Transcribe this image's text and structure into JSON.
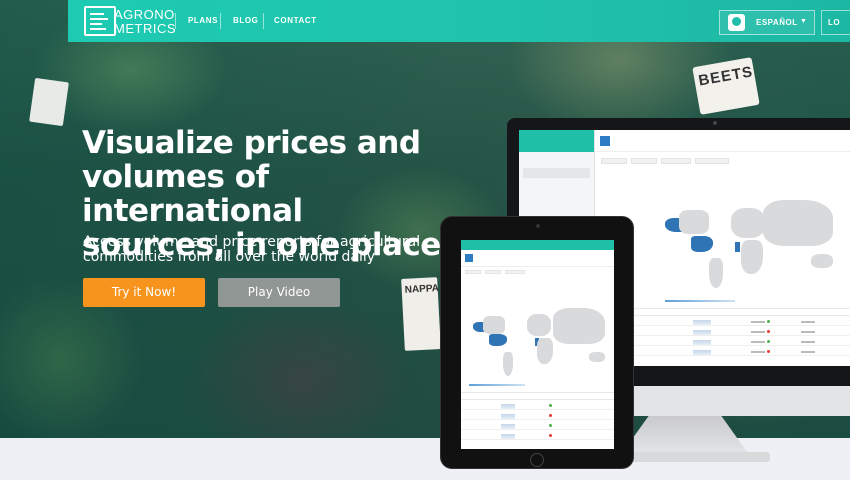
{
  "nav": {
    "brand_line1": "AGRONO",
    "brand_line2": "METRICS",
    "links": [
      "PLANS",
      "BLOG",
      "CONTACT"
    ],
    "language": "ESPAÑOL",
    "login": "LO"
  },
  "hero": {
    "headline_line1": "Visualize prices and",
    "headline_line2": "volumes of international",
    "headline_line3": "sources, in one place",
    "subline_line1": "Access volume and price reports for agricultural",
    "subline_line2": "commodities from all over the world daily",
    "cta_primary": "Try it Now!",
    "cta_secondary": "Play Video"
  },
  "photo_tags": {
    "beets": "BEETS",
    "nappa": "NAPPA"
  },
  "colors": {
    "teal": "#1fbfa8",
    "orange": "#f7941d",
    "gray_button": "#8f9693",
    "map_highlight": "#2f74b5"
  }
}
